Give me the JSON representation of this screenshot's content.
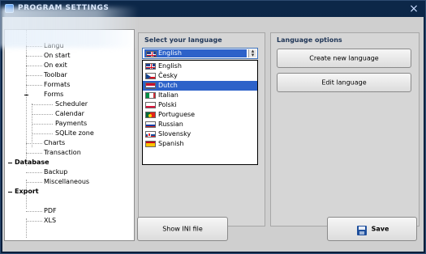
{
  "window": {
    "title": "PROGRAM SETTINGS",
    "close_glyph": "×"
  },
  "tree": {
    "items": [
      {
        "label": "Langu"
      },
      {
        "label": "On start"
      },
      {
        "label": "On exit"
      },
      {
        "label": "Toolbar"
      },
      {
        "label": "Formats"
      },
      {
        "label": "Forms"
      },
      {
        "label": "Scheduler"
      },
      {
        "label": "Calendar"
      },
      {
        "label": "Payments"
      },
      {
        "label": "SQLite zone"
      },
      {
        "label": "Charts"
      },
      {
        "label": "Transaction"
      },
      {
        "label": "Database"
      },
      {
        "label": "Backup"
      },
      {
        "label": "Miscellaneous"
      },
      {
        "label": "Export"
      },
      {
        "label": "PDF"
      },
      {
        "label": "XLS"
      }
    ]
  },
  "language_group": {
    "title": "Select your language",
    "selected": "English",
    "options": [
      {
        "label": "English",
        "flag": "uk-flag"
      },
      {
        "label": "Česky",
        "flag": "czech-flag"
      },
      {
        "label": "Dutch",
        "flag": "dutch-flag"
      },
      {
        "label": "Italian",
        "flag": "italian-flag"
      },
      {
        "label": "Polski",
        "flag": "polish-flag"
      },
      {
        "label": "Portuguese",
        "flag": "portuguese-flag"
      },
      {
        "label": "Russian",
        "flag": "russian-flag"
      },
      {
        "label": "Slovensky",
        "flag": "slovak-flag"
      },
      {
        "label": "Spanish",
        "flag": "spanish-flag"
      }
    ],
    "highlighted": "Dutch"
  },
  "options_group": {
    "title": "Language options",
    "create_label": "Create new language",
    "edit_label": "Edit language"
  },
  "footer": {
    "show_ini_label": "Show INI file",
    "save_label": "Save"
  },
  "colors": {
    "selection": "#2d62c9",
    "title_bar": "#0c2748",
    "group_title": "#1f3556"
  }
}
